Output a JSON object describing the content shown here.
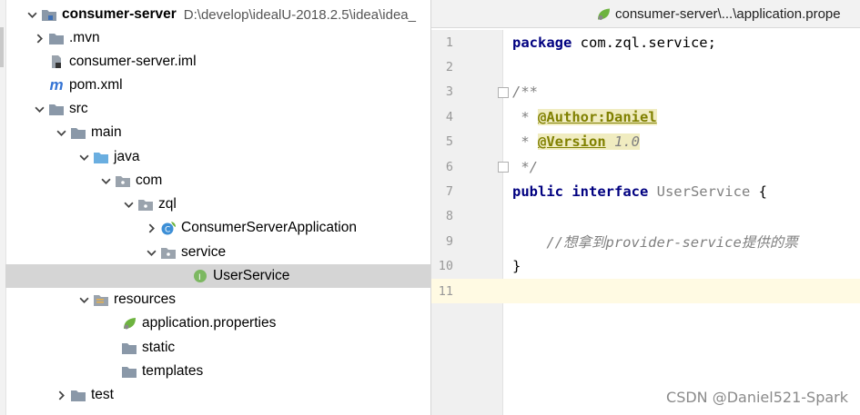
{
  "tree": {
    "root": {
      "label": "consumer-server",
      "path": "D:\\develop\\idealU-2018.2.5\\idea\\idea_"
    },
    "items": [
      {
        "label": ".mvn"
      },
      {
        "label": "consumer-server.iml"
      },
      {
        "label": "pom.xml"
      },
      {
        "label": "src"
      },
      {
        "label": "main"
      },
      {
        "label": "java"
      },
      {
        "label": "com"
      },
      {
        "label": "zql"
      },
      {
        "label": "ConsumerServerApplication"
      },
      {
        "label": "service"
      },
      {
        "label": "UserService"
      },
      {
        "label": "resources"
      },
      {
        "label": "application.properties"
      },
      {
        "label": "static"
      },
      {
        "label": "templates"
      },
      {
        "label": "test"
      }
    ],
    "selected": "UserService"
  },
  "editor": {
    "tab_title": "consumer-server\\...\\application.prope",
    "line_numbers": [
      "1",
      "2",
      "3",
      "4",
      "5",
      "6",
      "7",
      "8",
      "9",
      "10",
      "11"
    ],
    "code": {
      "l1_kw": "package",
      "l1_rest": " com.zql.service;",
      "l3": "/**",
      "l4_prefix": " * ",
      "l4_ann": "@Author:Daniel",
      "l5_prefix": " * ",
      "l5_ann": "@Version",
      "l5_val": " 1.0",
      "l6": " */",
      "l7_kw": "public interface",
      "l7_name": " UserService",
      "l7_rest": " {",
      "l9": "    //想拿到provider-service提供的票",
      "l10": "}"
    },
    "current_line": 11
  },
  "watermark": "CSDN @Daniel521-Spark",
  "colors": {
    "keyword": "#000080",
    "comment": "#808080",
    "annotation": "#808000",
    "selection": "#d5d5d5",
    "current_line": "#fffae3"
  }
}
